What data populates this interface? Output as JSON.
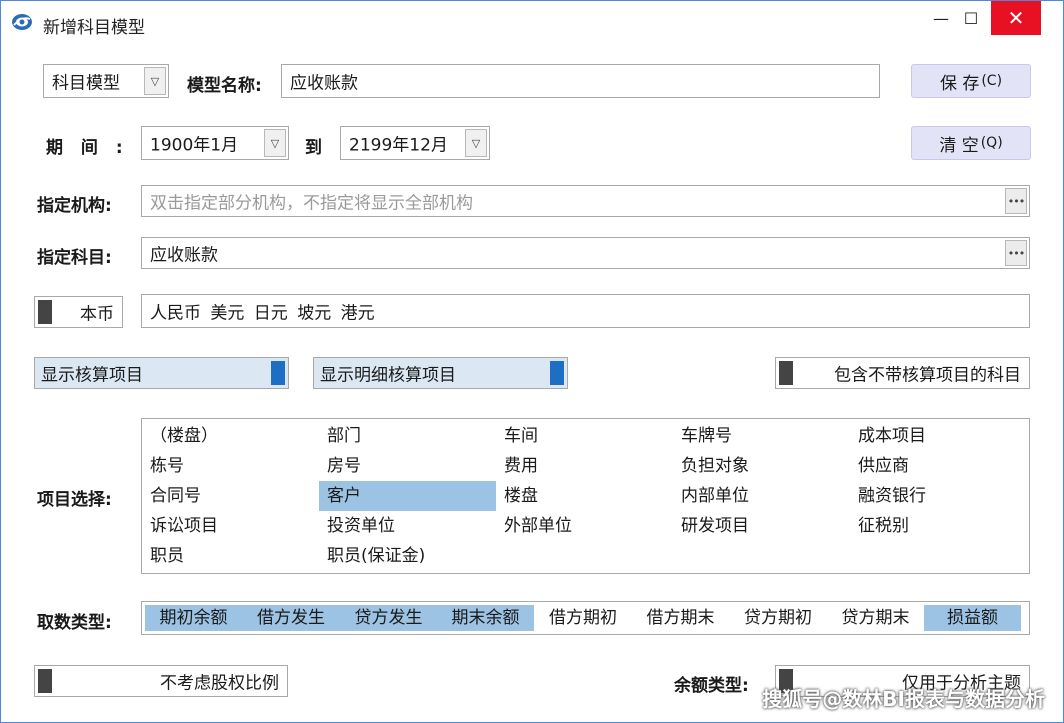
{
  "window": {
    "title": "新增科目模型",
    "minimize_glyph": "—",
    "maximize_glyph": "☐",
    "close_glyph": "✕"
  },
  "header": {
    "model_type_value": "科目模型",
    "model_name_label": "模型名称:",
    "model_name_value": "应收账款",
    "save_label": "保 存",
    "save_key": "(C)",
    "clear_label": "清 空",
    "clear_key": "(Q)"
  },
  "period": {
    "label": "期  间 :",
    "from_value": "1900年1月",
    "to_label": "到",
    "to_value": "2199年12月"
  },
  "org": {
    "label": "指定机构:",
    "placeholder": "双击指定部分机构，不指定将显示全部机构"
  },
  "subject": {
    "label": "指定科目:",
    "value": "应收账款"
  },
  "currency": {
    "toggle_label": "本币",
    "value": "人民币 美元 日元 坡元 港元"
  },
  "options": {
    "show_accounting_items": "显示核算项目",
    "show_detail_items": "显示明细核算项目",
    "include_subjects": "包含不带核算项目的科目"
  },
  "items": {
    "label": "项目选择:",
    "columns": [
      [
        "（楼盘）",
        "栋号",
        "合同号",
        "诉讼项目",
        "职员"
      ],
      [
        "部门",
        "房号",
        "客户",
        "投资单位",
        "职员(保证金)"
      ],
      [
        "车间",
        "费用",
        "楼盘",
        "外部单位"
      ],
      [
        "车牌号",
        "负担对象",
        "内部单位",
        "研发项目"
      ],
      [
        "成本项目",
        "供应商",
        "融资银行",
        "征税别"
      ]
    ],
    "selected": "客户"
  },
  "fetch": {
    "label": "取数类型:",
    "types": [
      "期初余额",
      "借方发生",
      "贷方发生",
      "期末余额",
      "借方期初",
      "借方期末",
      "贷方期初",
      "贷方期末",
      "损益额"
    ],
    "selected": [
      true,
      true,
      true,
      true,
      false,
      false,
      false,
      false,
      true
    ]
  },
  "footer": {
    "equity_toggle": "不考虑股权比例",
    "balance_type_label": "余额类型:",
    "balance_type_toggle": "仅用于分析主题"
  },
  "watermark": "搜狐号@数林BI报表与数据分析",
  "colors": {
    "accent": "#1c6fc2",
    "selection": "#9cc3e3",
    "button_bg": "#e3e3f7",
    "close_red": "#e81123"
  }
}
